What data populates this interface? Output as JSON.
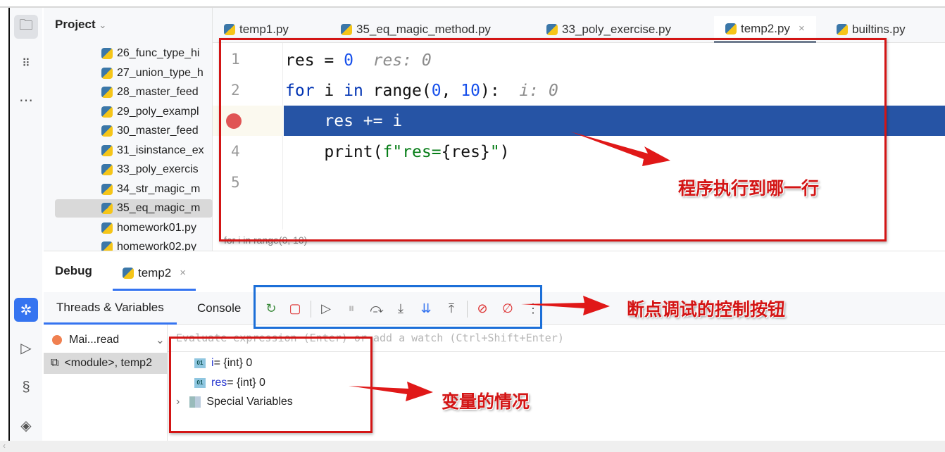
{
  "sidebar_icons": [
    "folder-icon",
    "structure-icon",
    "more-icon",
    "debug-icon",
    "run-icon",
    "python-console-icon",
    "layers-icon"
  ],
  "project": {
    "title": "Project",
    "files": [
      "26_func_type_hi",
      "27_union_type_h",
      "28_master_feed",
      "29_poly_exampl",
      "30_master_feed",
      "31_isinstance_ex",
      "33_poly_exercis",
      "34_str_magic_m",
      "35_eq_magic_m",
      "homework01.py",
      "homework02.py"
    ],
    "selected_index": 8
  },
  "tabs": [
    {
      "label": "temp1.py"
    },
    {
      "label": "35_eq_magic_method.py"
    },
    {
      "label": "33_poly_exercise.py"
    },
    {
      "label": "temp2.py",
      "active": true,
      "close": "×"
    },
    {
      "label": "builtins.py"
    }
  ],
  "editor": {
    "line_numbers": [
      "1",
      "2",
      "",
      "4",
      "5"
    ],
    "l1": {
      "a": "res = ",
      "n": "0",
      "hint": "  res: 0"
    },
    "l2": {
      "kw": "for",
      "a": " i ",
      "kw2": "in",
      "b": " range(",
      "n1": "0",
      "c": ", ",
      "n2": "10",
      "d": "):",
      "hint": "  i: 0"
    },
    "l3": "    res += i",
    "l4": {
      "a": "    print(",
      "s": "f\"res=",
      "b": "{res}",
      "s2": "\"",
      "c": ")"
    },
    "breadcrumb": "for i in range(0, 10)"
  },
  "debug": {
    "title": "Debug",
    "session": "temp2",
    "session_close": "×",
    "subtabs": [
      "Threads & Variables",
      "Console"
    ],
    "toolbar": [
      "rerun",
      "stop",
      "resume",
      "pause",
      "step-over",
      "step-into",
      "step-into-my-code",
      "step-out",
      "view-breakpoints",
      "mute-breakpoints",
      "more"
    ],
    "thread": "Mai...read",
    "frame": "<module>, temp2",
    "evaluate_placeholder": "Evaluate expression (Enter) or add a watch (Ctrl+Shift+Enter)",
    "variables": [
      {
        "badge": "01",
        "name": "i",
        "value": " = {int} 0"
      },
      {
        "badge": "01",
        "name": "res",
        "value": " = {int} 0"
      }
    ],
    "special": "Special Variables"
  },
  "annotations": {
    "current_line": "程序执行到哪一行",
    "controls": "断点调试的控制按钮",
    "variables": "变量的情况"
  },
  "colors": {
    "highlight": "#2654a5",
    "annotation_red": "#d31515",
    "annotation_blue": "#1c6fd8",
    "breakpoint": "#e05555"
  }
}
